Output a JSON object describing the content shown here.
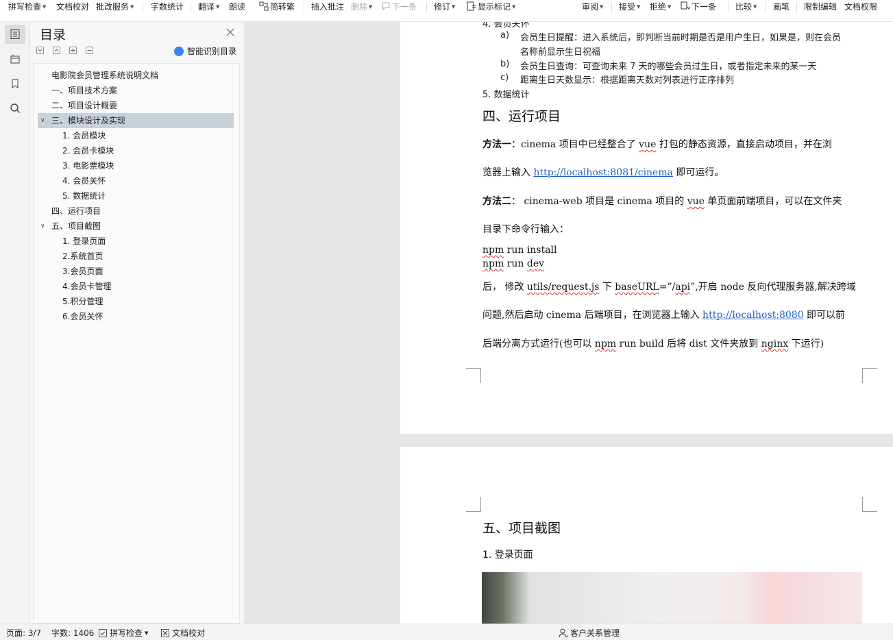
{
  "toolbar": {
    "spell_check": "拼写检查",
    "doc_proof": "文档校对",
    "revise_service": "批改服务",
    "word_count": "字数统计",
    "translate": "翻译",
    "read_aloud": "朗读",
    "simp_trad": "简转繁",
    "insert_comment": "插入批注",
    "delete": "删除",
    "next_comment": "下一条",
    "revise": "修订",
    "show_markup": "显示标记",
    "review": "审阅",
    "accept": "接受",
    "reject": "拒绝",
    "next_change": "下一条",
    "compare": "比较",
    "pen": "画笔",
    "restrict_edit": "限制编辑",
    "doc_permission": "文档权限"
  },
  "toc": {
    "title": "目录",
    "smart_label": "智能识别目录",
    "items": [
      {
        "label": "电影院会员管理系统说明文档",
        "level": 0
      },
      {
        "label": "一、项目技术方案",
        "level": 1
      },
      {
        "label": "二、项目设计概要",
        "level": 1
      },
      {
        "label": "三、模块设计及实现",
        "level": 1
      },
      {
        "label": "1.  会员模块",
        "level": 2
      },
      {
        "label": "2.  会员卡模块",
        "level": 2
      },
      {
        "label": "3.  电影票模块",
        "level": 2
      },
      {
        "label": "4.  会员关怀",
        "level": 2
      },
      {
        "label": "5.  数据统计",
        "level": 2
      },
      {
        "label": "四、运行项目",
        "level": 1
      },
      {
        "label": "五、项目截图",
        "level": 1
      },
      {
        "label": "1.  登录页面",
        "level": 2
      },
      {
        "label": "2.系统首页",
        "level": 2
      },
      {
        "label": "3.会员页面",
        "level": 2
      },
      {
        "label": "4.会员卡管理",
        "level": 2
      },
      {
        "label": "5.积分管理",
        "level": 2
      },
      {
        "label": "6.会员关怀",
        "level": 2
      }
    ]
  },
  "document": {
    "cut_line": "4.  会员关怀",
    "list_a_mark": "a)",
    "list_a_line1": "会员生日提醒：进入系统后，即判断当前时期是否是用户生日，如果是，则在会员",
    "list_a_line2": "名称前显示生日祝福",
    "list_b_mark": "b)",
    "list_b": "会员生日查询：可查询未来 7 天的哪些会员过生日，或者指定未来的某一天",
    "list_c_mark": "c)",
    "list_c": "距离生日天数显示：根据距离天数对列表进行正序排列",
    "item5": "5.  数据统计",
    "heading4": "四、运行项目",
    "m1_label": "方法一",
    "m1_text_a": "：cinema 项目中已经整合了 ",
    "m1_vue": "vue",
    "m1_text_b": " 打包的静态资源，直接启动项目，并在浏",
    "m1_line2_a": "览器上输入 ",
    "m1_link": "http://localhost:8081/cinema",
    "m1_line2_b": "  即可运行。",
    "m2_label": "方法二",
    "m2_text_a": "：  cinema-web 项目是 cinema 项目的 ",
    "m2_vue": "vue",
    "m2_text_b": " 单页面前端项目，可以在文件夹",
    "m2_line2": "目录下命令行输入：",
    "npm1_a": "npm",
    "npm1_b": " run install",
    "npm2_a": "npm",
    "npm2_b": " run ",
    "npm2_c": "dev",
    "after_a": "后，  修改 ",
    "after_utils": "utils/request.js",
    "after_b": " 下 ",
    "after_base": "baseURL",
    "after_c": "=”/",
    "after_api": "api",
    "after_d": "”,开启 node 反向代理服务器,解决跨域",
    "after2_a": "问题,然后启动 cinema 后端项目，在浏览器上输入  ",
    "after2_link": "http://localhost:8080",
    "after2_b": "  即可以前",
    "after3_a": "后端分离方式运行(也可以 ",
    "after3_npm": "npm",
    "after3_b": " run build 后将 dist 文件夹放到 ",
    "after3_nginx": "nginx",
    "after3_c": " 下运行)",
    "heading5": "五、项目截图",
    "sub1": "1.  登录页面"
  },
  "status": {
    "page": "页面: 3/7",
    "words": "字数: 1406",
    "spell": "拼写检查",
    "proof": "文档校对",
    "crm": "客户关系管理"
  }
}
